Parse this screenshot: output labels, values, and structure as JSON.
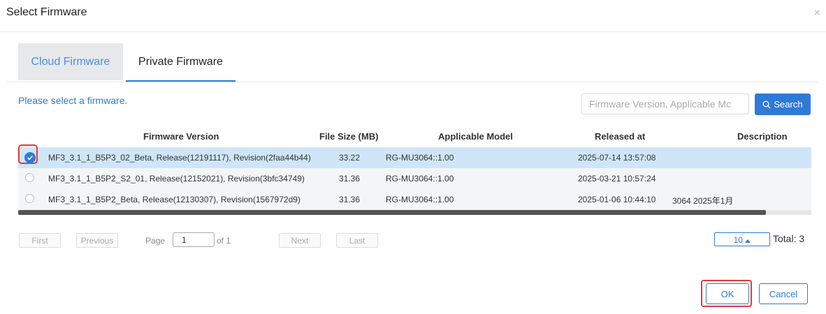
{
  "dialog": {
    "title": "Select Firmware",
    "close_glyph": "×"
  },
  "tabs": [
    {
      "label": "Cloud Firmware",
      "active": true
    },
    {
      "label": "Private Firmware",
      "active": false
    }
  ],
  "hint": "Please select a firmware.",
  "search": {
    "placeholder": "Firmware Version, Applicable Mc",
    "button_label": "Search",
    "icon": "search-icon"
  },
  "table": {
    "headers": [
      "Firmware Version",
      "File Size (MB)",
      "Applicable Model",
      "Released at",
      "Description"
    ],
    "rows": [
      {
        "selected": true,
        "version": "MF3_3.1_1_B5P3_02_Beta, Release(12191117), Revision(2faa44b44)",
        "size": "33.22",
        "model": "RG-MU3064::1.00",
        "released": "2025-07-14 13:57:08",
        "description": ""
      },
      {
        "selected": false,
        "version": "MF3_3.1_1_B5P2_S2_01, Release(12152021), Revision(3bfc34749)",
        "size": "31.36",
        "model": "RG-MU3064::1.00",
        "released": "2025-03-21 10:57:24",
        "description": ""
      },
      {
        "selected": false,
        "version": "MF3_3.1_1_B5P2_Beta, Release(12130307), Revision(1567972d9)",
        "size": "31.36",
        "model": "RG-MU3064::1.00",
        "released": "2025-01-06 10:44:10",
        "description": "3064 2025年1月"
      }
    ]
  },
  "pagination": {
    "first": "First",
    "previous": "Previous",
    "page_label": "Page",
    "page_value": "1",
    "of_label": "of 1",
    "next": "Next",
    "last": "Last",
    "page_size": "10",
    "total": "Total: 3"
  },
  "footer": {
    "ok": "OK",
    "cancel": "Cancel"
  },
  "colors": {
    "accent": "#2f7ad9",
    "selected_row": "#cfe6f8",
    "highlight": "#e53935"
  }
}
